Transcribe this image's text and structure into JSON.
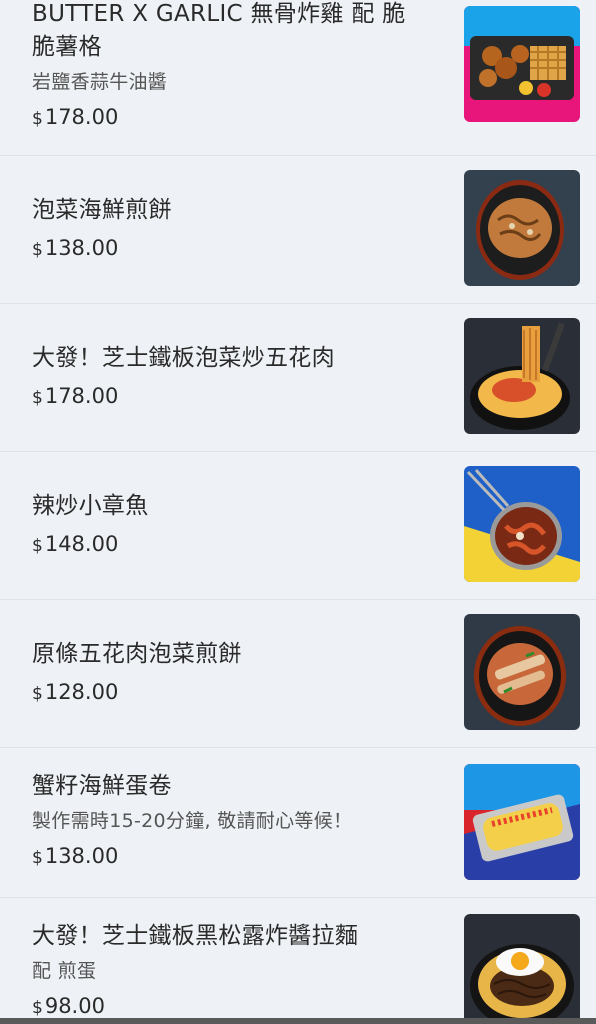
{
  "currency_symbol": "$",
  "items": [
    {
      "name_line1": "BUTTER X GARLIC 無骨炸雞 配 脆",
      "name_line2": "脆薯格",
      "desc": "岩鹽香蒜牛油醬",
      "price": "178.00",
      "image_icon": "fried-chicken-waffle-fries-photo"
    },
    {
      "name_line1": "泡菜海鮮煎餅",
      "price": "138.00",
      "image_icon": "kimchi-seafood-pancake-photo"
    },
    {
      "name_line1": "大發！芝士鐵板泡菜炒五花肉",
      "price": "178.00",
      "image_icon": "cheese-kimchi-pork-skillet-photo"
    },
    {
      "name_line1": "辣炒小章魚",
      "price": "148.00",
      "image_icon": "spicy-baby-octopus-photo"
    },
    {
      "name_line1": "原條五花肉泡菜煎餅",
      "price": "128.00",
      "image_icon": "pork-belly-kimchi-pancake-photo"
    },
    {
      "name_line1": "蟹籽海鮮蛋卷",
      "desc": "製作需時15-20分鐘, 敬請耐心等候！",
      "price": "138.00",
      "image_icon": "roe-seafood-egg-roll-photo"
    },
    {
      "name_line1": "大發！芝士鐵板黑松露炸醬拉麵",
      "desc": "配 煎蛋",
      "price": "98.00",
      "image_icon": "truffle-jjajang-ramen-egg-photo"
    }
  ]
}
